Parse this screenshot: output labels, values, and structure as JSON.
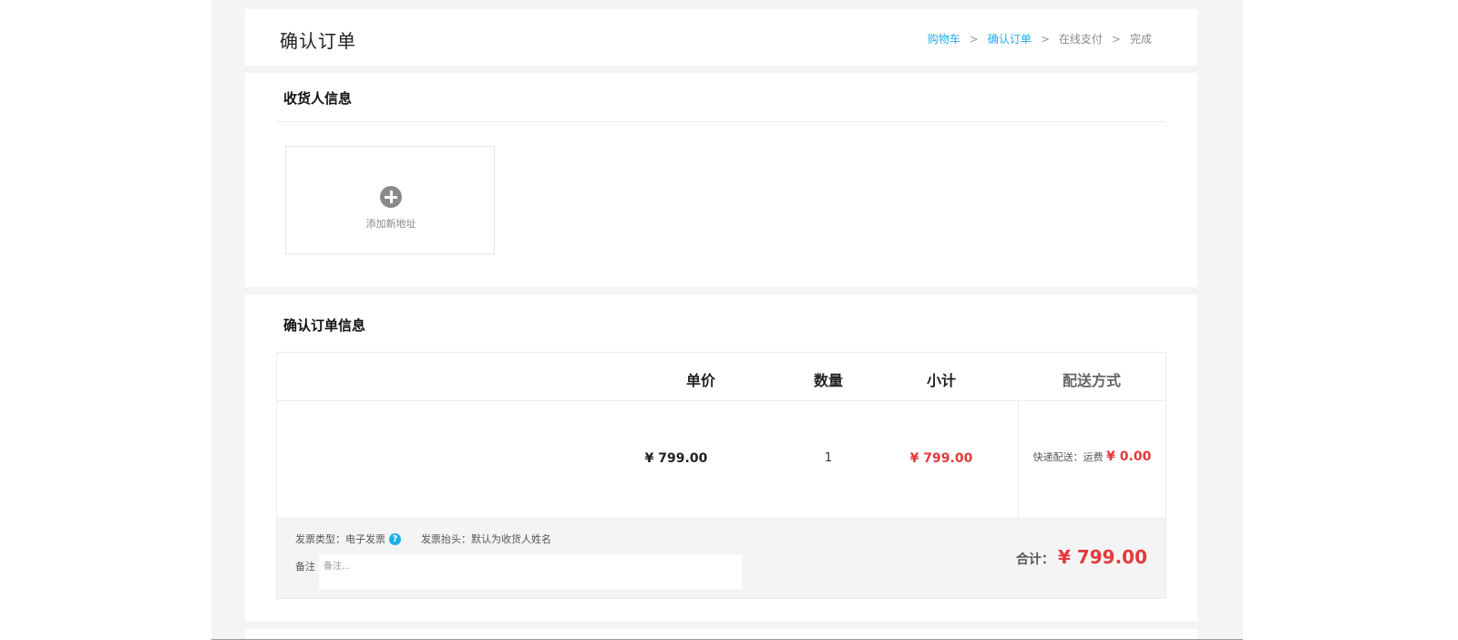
{
  "header": {
    "title": "确认订单",
    "breadcrumb": [
      "购物车",
      "确认订单",
      "在线支付",
      "完成"
    ],
    "breadcrumb_sep": ">"
  },
  "consignee": {
    "title": "收货人信息",
    "add_address_label": "添加新地址"
  },
  "order": {
    "title": "确认订单信息",
    "columns": {
      "price": "单价",
      "quantity": "数量",
      "subtotal": "小计",
      "shipping": "配送方式"
    },
    "item": {
      "price": "¥ 799.00",
      "quantity": "1",
      "subtotal": "¥ 799.00"
    },
    "shipping": {
      "label": "快递配送：运费",
      "fee": "¥ 0.00"
    },
    "invoice": {
      "type": "发票类型：电子发票",
      "help": "?",
      "title": "发票抬头：默认为收货人姓名"
    },
    "remark": {
      "label": "备注",
      "placeholder": "备注..."
    },
    "total": {
      "label": "合计：",
      "value": "¥ 799.00"
    }
  },
  "colors": {
    "accent": "#1ab0e8",
    "price_red": "#e4393c"
  }
}
